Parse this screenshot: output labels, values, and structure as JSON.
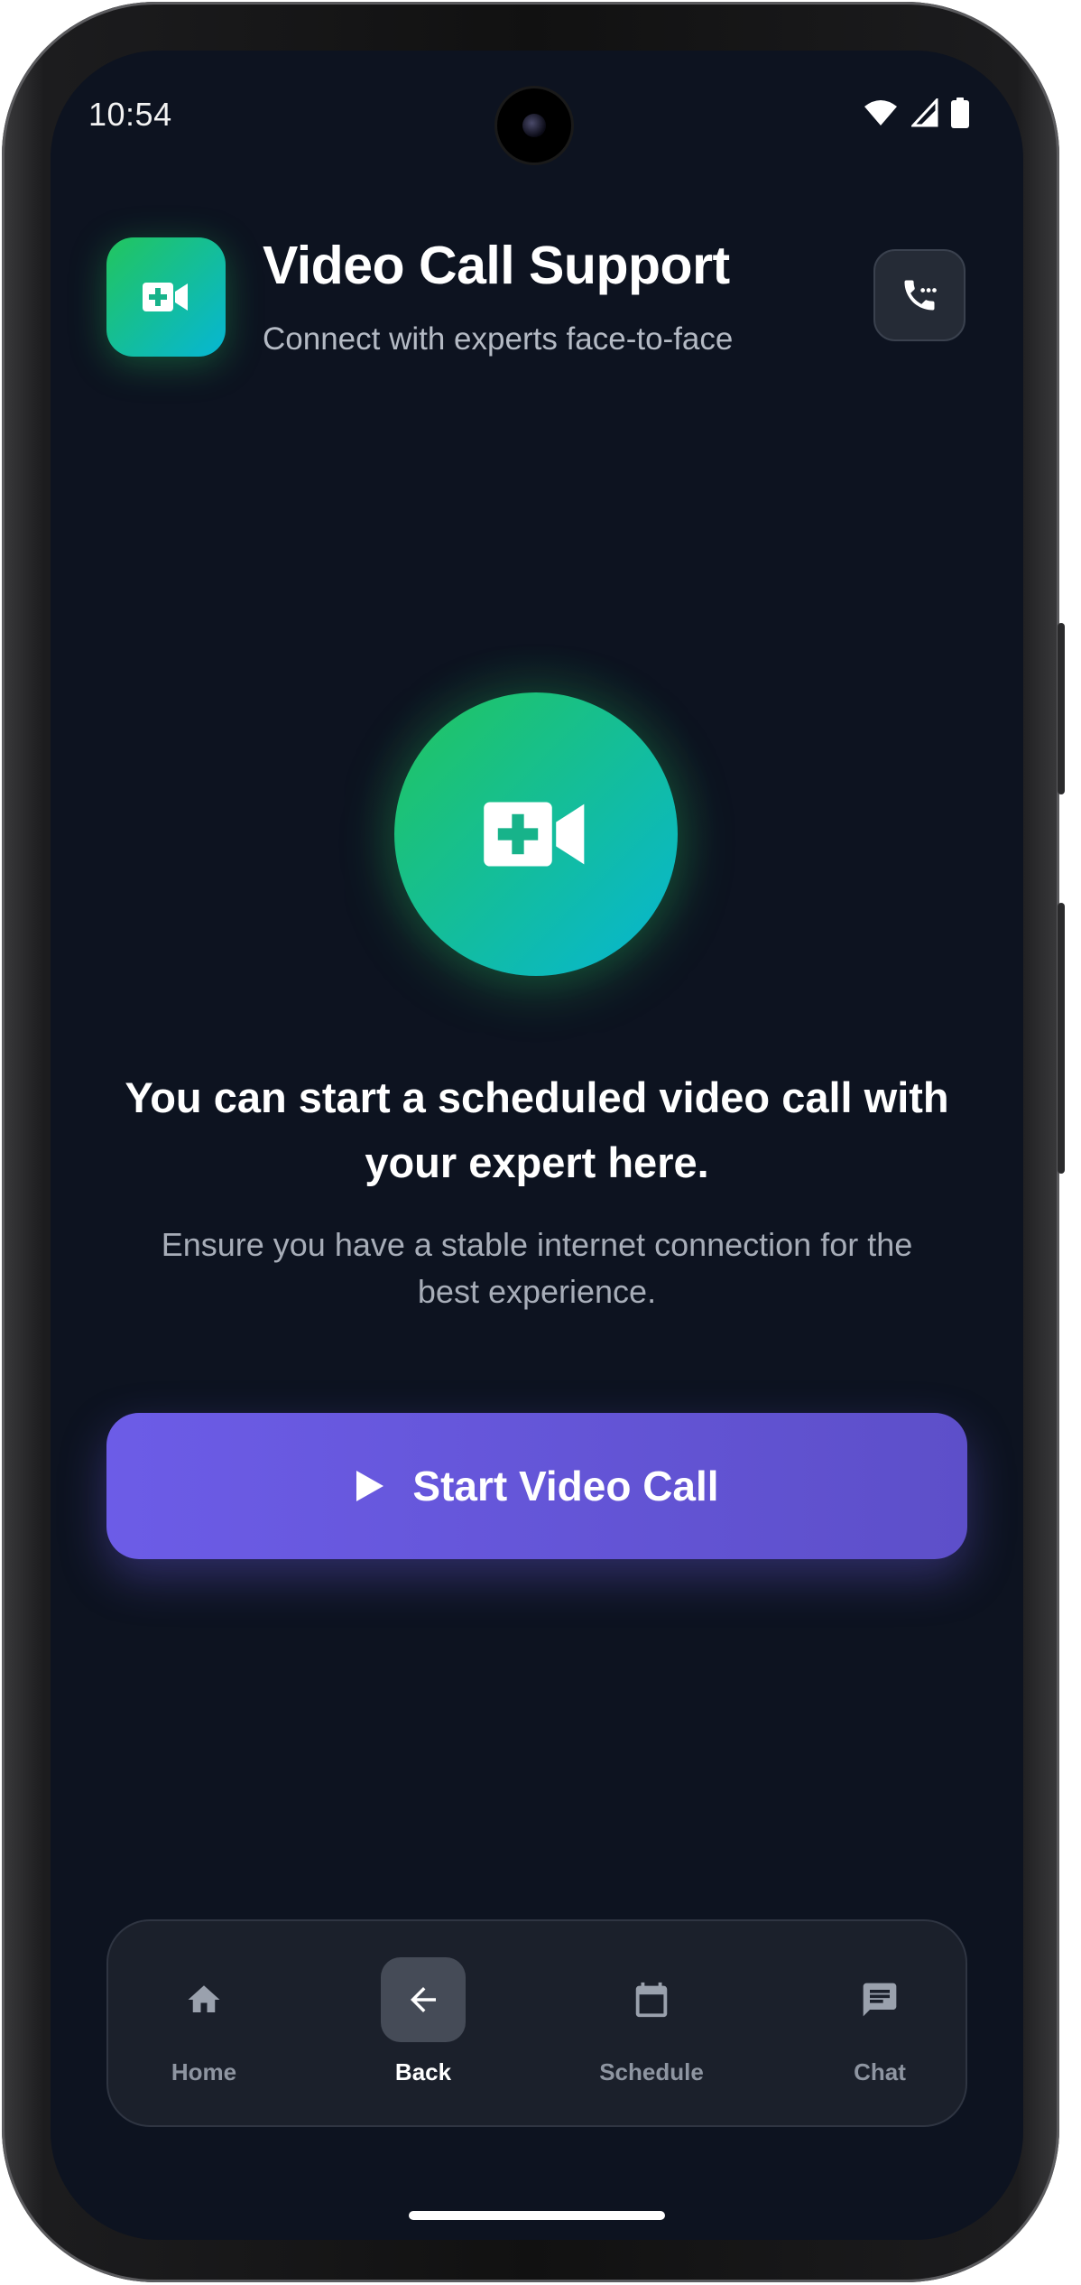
{
  "status_bar": {
    "time": "10:54",
    "icons": [
      "wifi-icon",
      "signal-icon",
      "battery-icon"
    ]
  },
  "header": {
    "icon": "video-plus-icon",
    "title": "Video Call Support",
    "subtitle": "Connect with experts face-to-face",
    "action_icon": "phone-dots-icon"
  },
  "hero": {
    "icon": "video-plus-icon",
    "headline": "You can start a scheduled video call with your expert here.",
    "note": "Ensure you have a stable internet connection for the best experience."
  },
  "cta": {
    "icon": "play-icon",
    "label": "Start Video Call"
  },
  "bottom_nav": {
    "items": [
      {
        "label": "Home",
        "icon": "home-icon",
        "active": false
      },
      {
        "label": "Back",
        "icon": "arrow-left-icon",
        "active": true
      },
      {
        "label": "Schedule",
        "icon": "calendar-icon",
        "active": false
      },
      {
        "label": "Chat",
        "icon": "chat-icon",
        "active": false
      }
    ]
  },
  "colors": {
    "background": "#0d1320",
    "accent_gradient_start": "#22c55e",
    "accent_gradient_end": "#06b6d4",
    "primary_button": "#6c5ce7"
  }
}
